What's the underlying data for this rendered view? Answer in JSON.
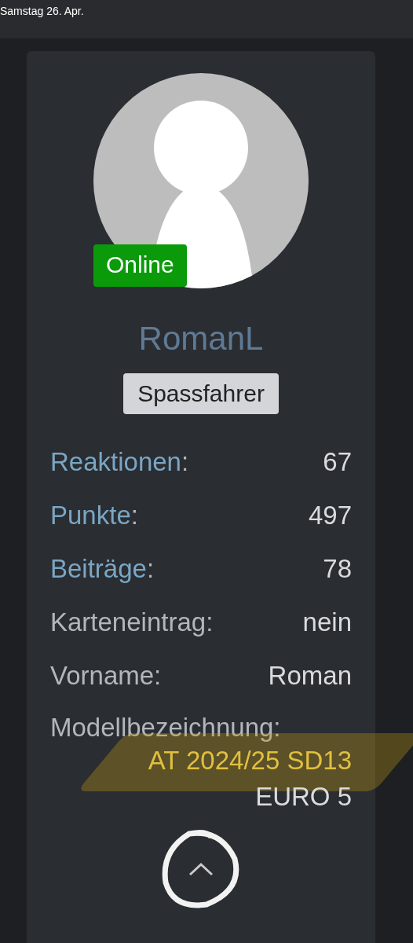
{
  "status_bar": {
    "date": "Samstag 26. Apr."
  },
  "profile": {
    "status_badge": "Online",
    "online": true,
    "username": "RomanL",
    "rank": "Spassfahrer"
  },
  "stats": [
    {
      "kind": "link",
      "label": "Reaktionen",
      "colon": ":",
      "value": "67"
    },
    {
      "kind": "link",
      "label": "Punkte",
      "colon": ":",
      "value": "497"
    },
    {
      "kind": "link",
      "label": "Beiträge",
      "colon": ":",
      "value": "78"
    },
    {
      "kind": "plain",
      "label": "Karteneintrag:",
      "value": "nein"
    },
    {
      "kind": "plain",
      "label": "Vorname:",
      "value": "Roman"
    }
  ],
  "model": {
    "label": "Modellbezeichnung:",
    "lines": [
      {
        "text": "AT 2024/25 SD13",
        "highlighted": true
      },
      {
        "text": "EURO 5",
        "highlighted": false
      }
    ]
  },
  "scroll_up": {
    "circled": true
  }
}
